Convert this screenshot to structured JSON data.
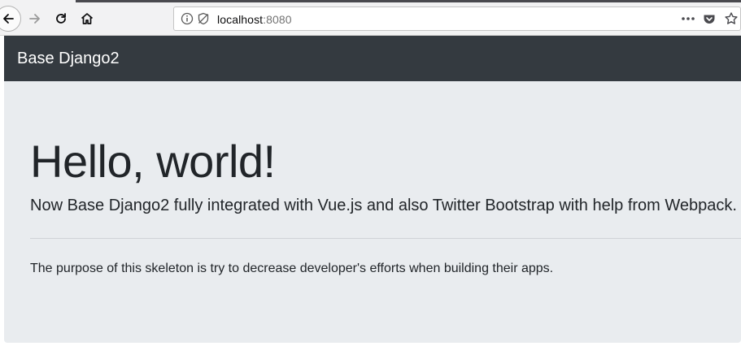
{
  "browser": {
    "url_host": "localhost",
    "url_port": ":8080",
    "icons": {
      "back": "arrow-left-icon",
      "forward": "arrow-right-icon",
      "reload": "reload-icon",
      "home": "home-icon",
      "info": "info-icon",
      "tracking": "tracking-protection-icon",
      "page_actions": "more-dots-icon",
      "pocket": "pocket-icon",
      "bookmark": "star-icon"
    }
  },
  "navbar": {
    "brand": "Base Django2"
  },
  "jumbotron": {
    "title": "Hello, world!",
    "lead": "Now Base Django2 fully integrated with Vue.js and also Twitter Bootstrap with help from Webpack.",
    "body": "The purpose of this skeleton is try to decrease developer's efforts when building their apps."
  },
  "colors": {
    "navbar_bg": "#343a40",
    "jumbotron_bg": "#e9ecef",
    "text": "#212529"
  }
}
